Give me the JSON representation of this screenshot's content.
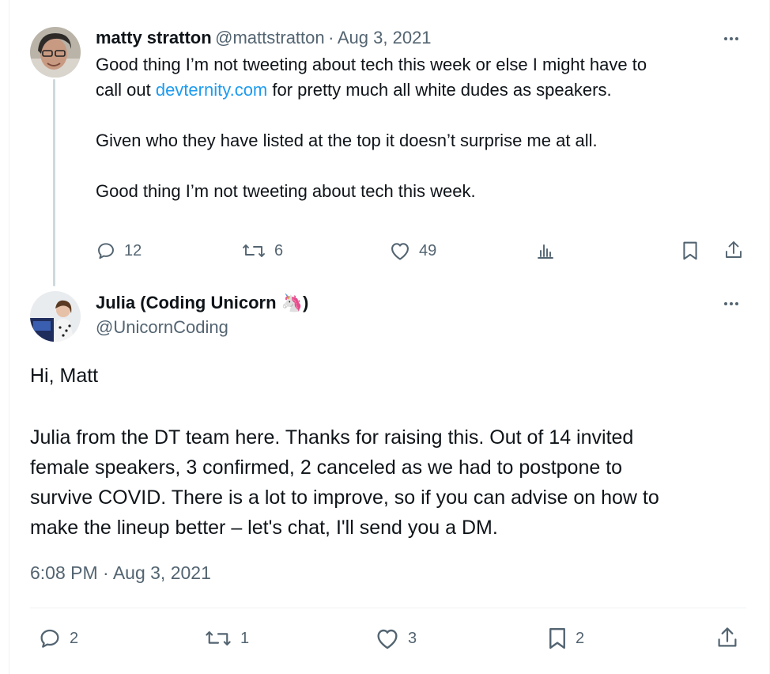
{
  "tweet1": {
    "name": "matty stratton",
    "handle": "@mattstratton",
    "separator": "·",
    "date": "Aug 3, 2021",
    "line1": "Good thing I’m not tweeting about tech this week or else I might have to",
    "line2_pre": "call out ",
    "line2_link": "devternity.com",
    "line2_post": " for pretty much all white dudes as speakers.",
    "line3": "Given who they have listed at the top it doesn’t surprise me at all.",
    "line4": "Good thing I’m not tweeting about tech this week.",
    "replies": "12",
    "retweets": "6",
    "likes": "49"
  },
  "tweet2": {
    "name": "Julia (Coding Unicorn 🦄)",
    "handle": "@UnicornCoding",
    "para1": "Hi, Matt",
    "para2_lines": [
      "Julia from the DT team here. Thanks for raising this. Out of 14 invited",
      "female speakers, 3 confirmed, 2 canceled as we had to postpone to",
      "survive COVID. There is a lot to improve, so if you can advise on how to",
      "make the lineup better – let's chat, I'll send you a DM."
    ],
    "timestamp": "6:08 PM · Aug 3, 2021",
    "replies": "2",
    "retweets": "1",
    "likes": "3",
    "bookmarks": "2"
  },
  "colors": {
    "text": "#0f1419",
    "secondary": "#536471",
    "link": "#1d9bf0",
    "thread_line": "#cfd9de"
  },
  "icons": [
    "reply-icon",
    "retweet-icon",
    "like-icon",
    "views-icon",
    "bookmark-icon",
    "share-icon",
    "more-icon"
  ]
}
